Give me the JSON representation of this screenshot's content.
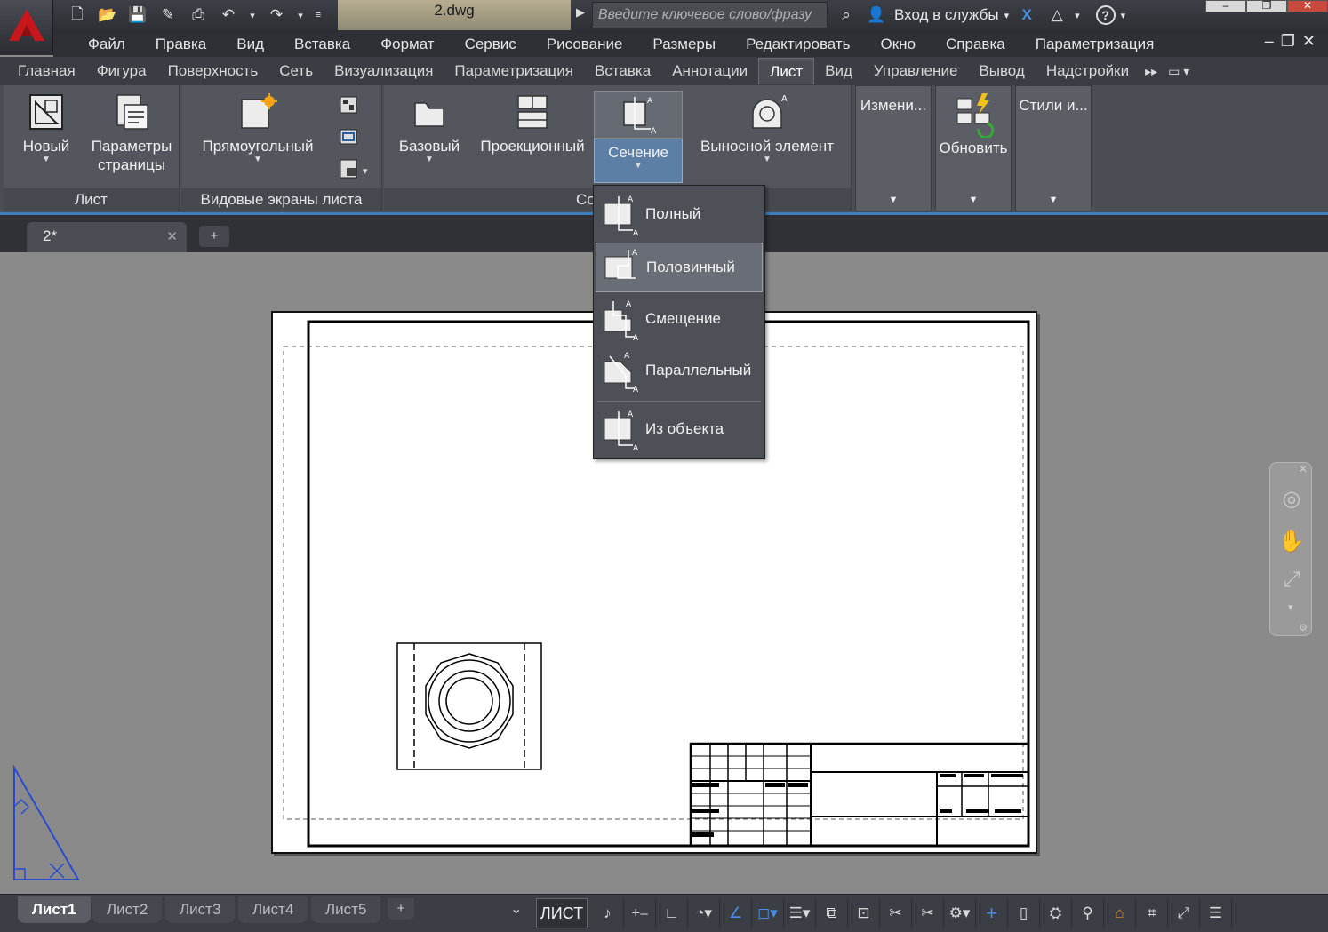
{
  "titlebar": {
    "file_name": "2.dwg",
    "search_placeholder": "Введите ключевое слово/фразу",
    "signin_label": "Вход в службы",
    "help_label": "?"
  },
  "menubar": {
    "items": [
      "Файл",
      "Правка",
      "Вид",
      "Вставка",
      "Формат",
      "Сервис",
      "Рисование",
      "Размеры",
      "Редактировать",
      "Окно",
      "Справка",
      "Параметризация"
    ]
  },
  "ribbon_tabs": {
    "items": [
      "Главная",
      "Фигура",
      "Поверхность",
      "Сеть",
      "Визуализация",
      "Параметризация",
      "Вставка",
      "Аннотации",
      "Лист",
      "Вид",
      "Управление",
      "Вывод",
      "Надстройки"
    ],
    "active": "Лист"
  },
  "ribbon": {
    "panel_layout": {
      "title": "Лист",
      "new_label": "Новый",
      "page_setup_line1": "Параметры",
      "page_setup_line2": "страницы"
    },
    "panel_viewports": {
      "title": "Видовые экраны листа",
      "rect_label": "Прямоугольный"
    },
    "panel_create_view": {
      "title_partial": "Со",
      "base_label": "Базовый",
      "projected_label": "Проекционный",
      "section_label": "Сечение",
      "detail_label": "Выносной элемент"
    },
    "panel_modify_label": "Измени...",
    "panel_update_label": "Обновить",
    "panel_styles_label": "Стили и..."
  },
  "section_dropdown": {
    "items": [
      {
        "label": "Полный"
      },
      {
        "label": "Половинный"
      },
      {
        "label": "Смещение"
      },
      {
        "label": "Параллельный"
      },
      {
        "label": "Из объекта"
      }
    ],
    "hovered": "Половинный"
  },
  "doc_tabs": {
    "active_tab": "2*"
  },
  "layout_tabs": {
    "items": [
      "Лист1",
      "Лист2",
      "Лист3",
      "Лист4",
      "Лист5"
    ],
    "active": "Лист1"
  },
  "statusbar": {
    "space_label": "ЛИСТ"
  },
  "colors": {
    "accent_blue": "#3e7fc0",
    "selected_button": "#5d7fa6",
    "ribbon_bg": "#4a4d53",
    "canvas_bg": "#8a8a8a",
    "logo_red": "#c8161d"
  }
}
